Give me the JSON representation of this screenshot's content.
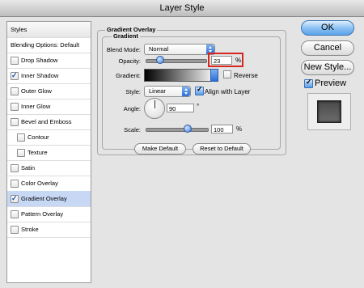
{
  "window": {
    "title": "Layer Style"
  },
  "styles_panel": {
    "header": "Styles",
    "items": [
      {
        "label": "Blending Options: Default",
        "checkbox": false,
        "checked": false,
        "indent": false,
        "selected": false
      },
      {
        "label": "Drop Shadow",
        "checkbox": true,
        "checked": false,
        "indent": false,
        "selected": false
      },
      {
        "label": "Inner Shadow",
        "checkbox": true,
        "checked": true,
        "indent": false,
        "selected": false
      },
      {
        "label": "Outer Glow",
        "checkbox": true,
        "checked": false,
        "indent": false,
        "selected": false
      },
      {
        "label": "Inner Glow",
        "checkbox": true,
        "checked": false,
        "indent": false,
        "selected": false
      },
      {
        "label": "Bevel and Emboss",
        "checkbox": true,
        "checked": false,
        "indent": false,
        "selected": false
      },
      {
        "label": "Contour",
        "checkbox": true,
        "checked": false,
        "indent": true,
        "selected": false
      },
      {
        "label": "Texture",
        "checkbox": true,
        "checked": false,
        "indent": true,
        "selected": false
      },
      {
        "label": "Satin",
        "checkbox": true,
        "checked": false,
        "indent": false,
        "selected": false
      },
      {
        "label": "Color Overlay",
        "checkbox": true,
        "checked": false,
        "indent": false,
        "selected": false
      },
      {
        "label": "Gradient Overlay",
        "checkbox": true,
        "checked": true,
        "indent": false,
        "selected": true
      },
      {
        "label": "Pattern Overlay",
        "checkbox": true,
        "checked": false,
        "indent": false,
        "selected": false
      },
      {
        "label": "Stroke",
        "checkbox": true,
        "checked": false,
        "indent": false,
        "selected": false
      }
    ]
  },
  "gradient_overlay": {
    "group_title": "Gradient Overlay",
    "sub_title": "Gradient",
    "blend_mode_label": "Blend Mode:",
    "blend_mode_value": "Normal",
    "opacity_label": "Opacity:",
    "opacity_value": "23",
    "opacity_unit": "%",
    "opacity_level": 0.23,
    "gradient_label": "Gradient:",
    "reverse_label": "Reverse",
    "reverse_checked": false,
    "style_label": "Style:",
    "style_value": "Linear",
    "align_label": "Align with Layer",
    "align_checked": true,
    "angle_label": "Angle:",
    "angle_value": "90",
    "angle_unit": "°",
    "scale_label": "Scale:",
    "scale_value": "100",
    "scale_unit": "%",
    "scale_level": 0.67,
    "make_default": "Make Default",
    "reset_default": "Reset to Default"
  },
  "buttons": {
    "ok": "OK",
    "cancel": "Cancel",
    "new_style": "New Style...",
    "preview": "Preview",
    "preview_checked": true
  },
  "colors": {
    "highlight_red": "#d4271d",
    "accent_blue": "#3a7fdc",
    "selection": "#c7d8f5"
  }
}
